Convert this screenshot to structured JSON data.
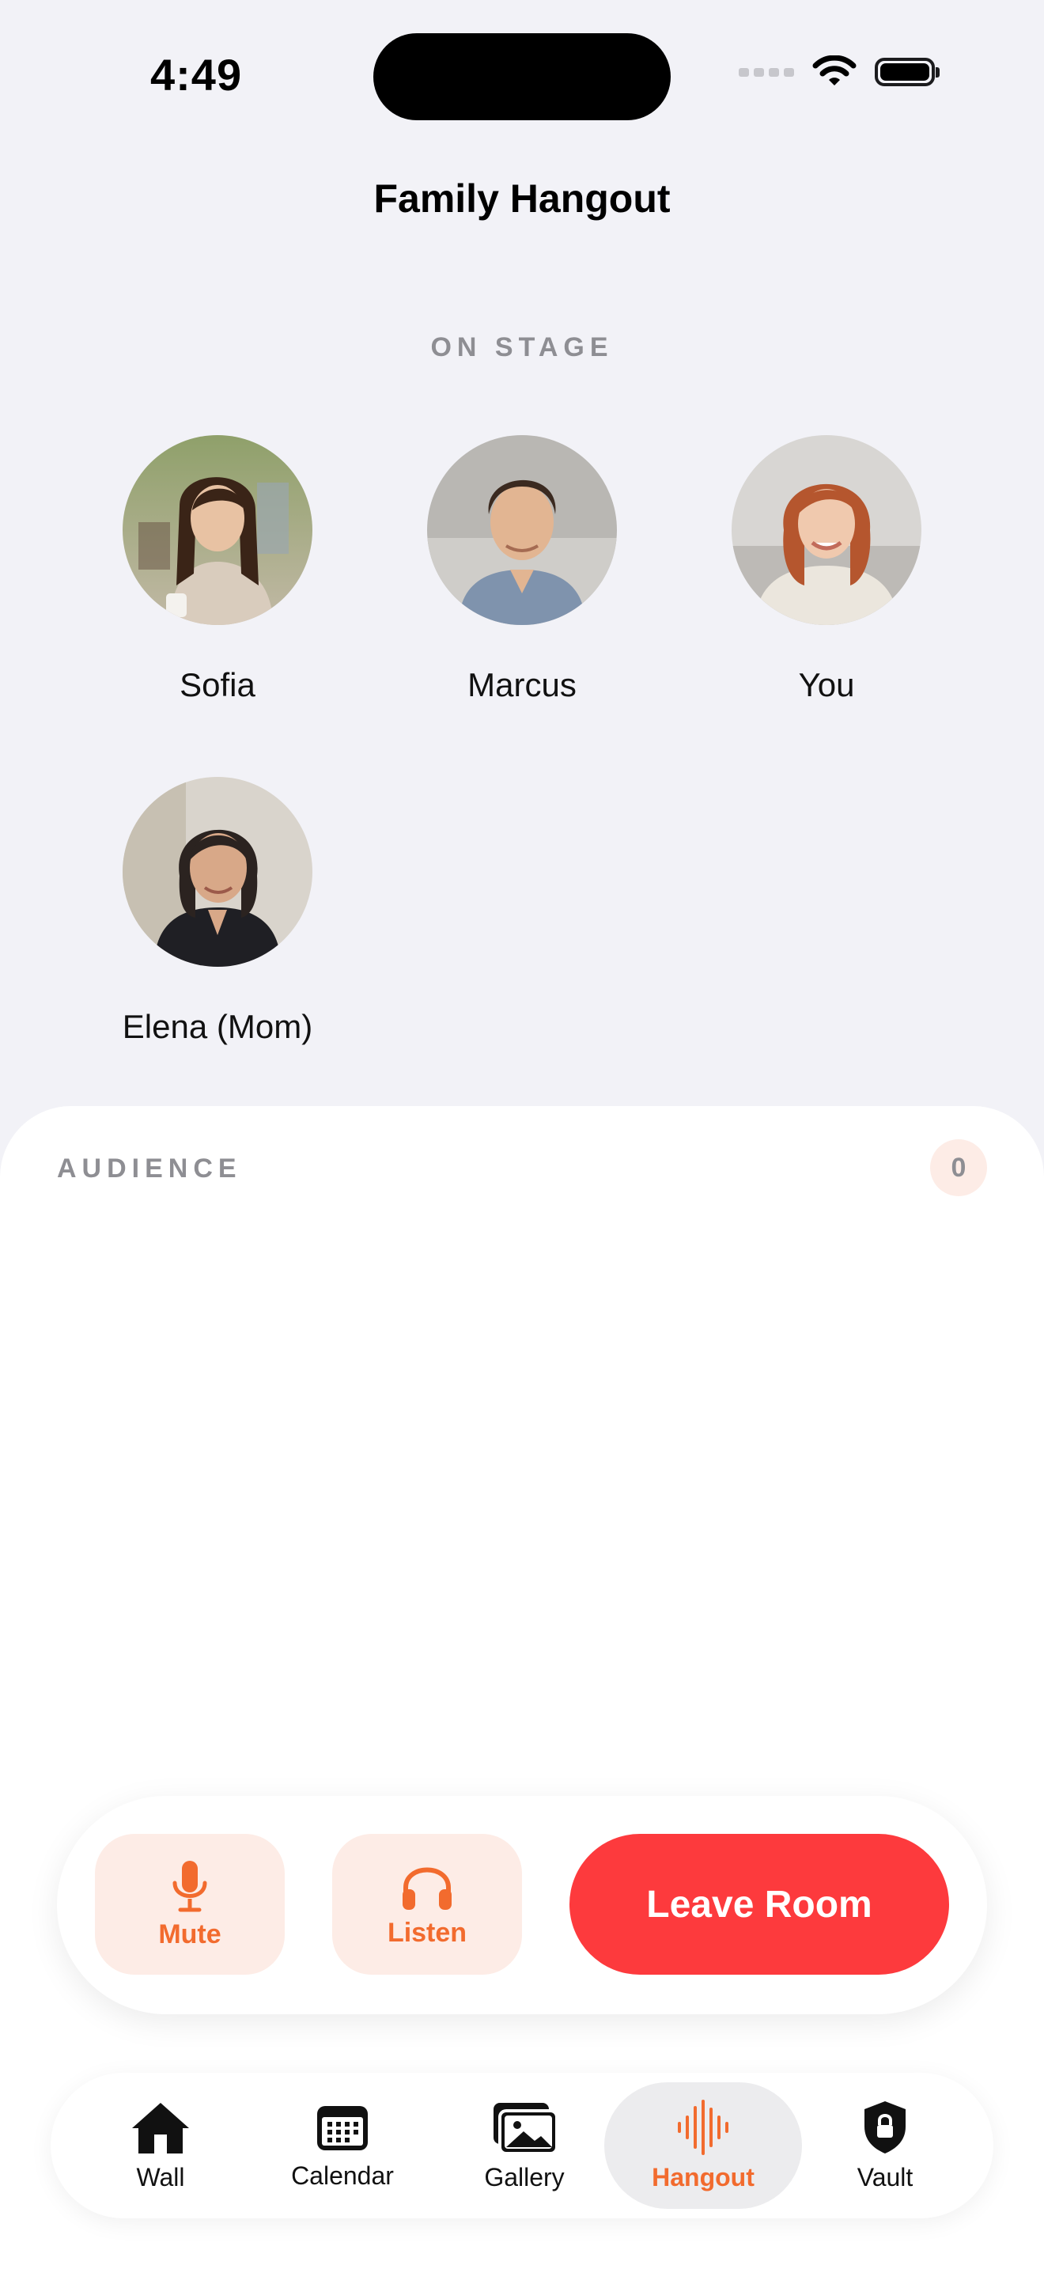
{
  "status_bar": {
    "time": "4:49"
  },
  "header": {
    "title": "Family Hangout"
  },
  "stage": {
    "label": "ON STAGE",
    "members": [
      {
        "name": "Sofia"
      },
      {
        "name": "Marcus"
      },
      {
        "name": "You"
      },
      {
        "name": "Elena (Mom)"
      }
    ]
  },
  "audience": {
    "label": "AUDIENCE",
    "count": "0"
  },
  "controls": {
    "mute_label": "Mute",
    "listen_label": "Listen",
    "leave_label": "Leave Room"
  },
  "tabs": [
    {
      "label": "Wall",
      "icon": "house-icon"
    },
    {
      "label": "Calendar",
      "icon": "calendar-icon"
    },
    {
      "label": "Gallery",
      "icon": "photos-icon"
    },
    {
      "label": "Hangout",
      "icon": "waveform-icon",
      "active": true
    },
    {
      "label": "Vault",
      "icon": "lock-shield-icon"
    }
  ],
  "colors": {
    "accent": "#f26b2e",
    "danger": "#fd3a3d",
    "accent_soft": "#fdece6",
    "background": "#f2f2f7"
  }
}
